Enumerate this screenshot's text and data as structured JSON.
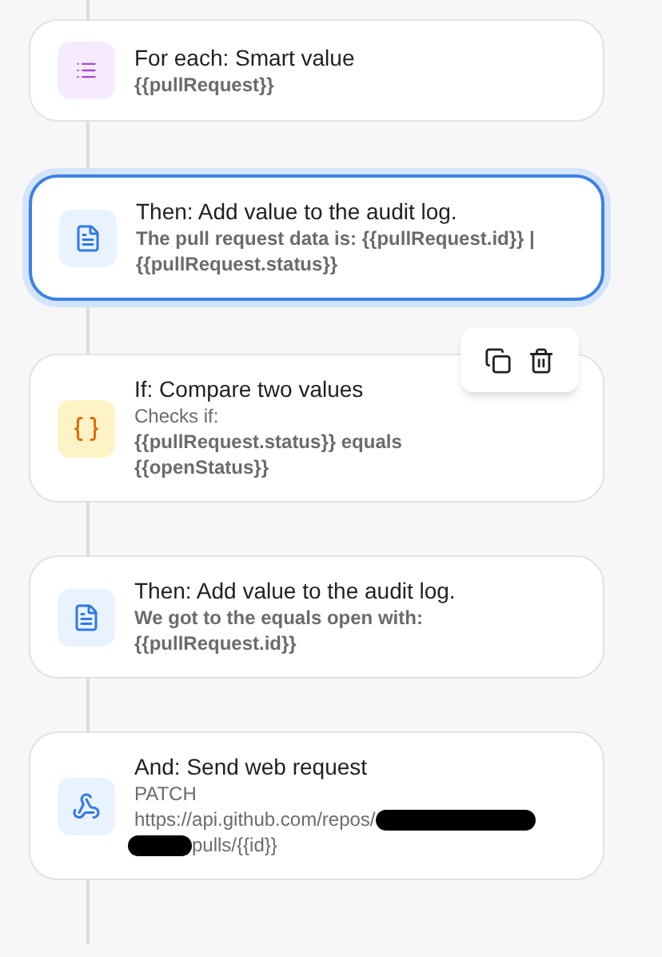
{
  "steps": [
    {
      "kind": "foreach",
      "title": "For each: Smart value",
      "selected": false,
      "actions_visible": false,
      "lines": [
        {
          "text": "{{pullRequest}}",
          "bold": true
        }
      ]
    },
    {
      "kind": "log",
      "title": "Then: Add value to the audit log.",
      "selected": true,
      "actions_visible": false,
      "lines": [
        {
          "text": "The pull request data is: {{pullRequest.id}} | {{pullRequest.status}}",
          "bold": true
        }
      ]
    },
    {
      "kind": "condition",
      "title": "If: Compare two values",
      "selected": false,
      "actions_visible": true,
      "lines": [
        {
          "text": "Checks if:",
          "bold": false
        },
        {
          "text": "{{pullRequest.status}} equals {{openStatus}}",
          "bold": true
        }
      ]
    },
    {
      "kind": "log",
      "title": "Then: Add value to the audit log.",
      "selected": false,
      "actions_visible": false,
      "lines": [
        {
          "text": "We got to the equals open with: {{pullRequest.id}}",
          "bold": true
        }
      ]
    },
    {
      "kind": "webhook",
      "title": "And: Send web request",
      "selected": false,
      "actions_visible": false,
      "lines": [
        {
          "text": "PATCH",
          "bold": false
        }
      ],
      "url_start": "https://api.github.com/repos/",
      "url_end": "pulls/{{id}}"
    }
  ]
}
